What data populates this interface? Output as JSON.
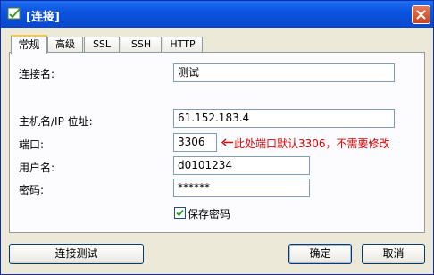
{
  "window": {
    "title": "[连接]",
    "accent_color": "#0b54e0"
  },
  "tabs": [
    {
      "label": "常规",
      "active": true
    },
    {
      "label": "高级",
      "active": false
    },
    {
      "label": "SSL",
      "active": false
    },
    {
      "label": "SSH",
      "active": false
    },
    {
      "label": "HTTP",
      "active": false
    }
  ],
  "form": {
    "connection_name_label": "连接名:",
    "connection_name_value": "测试",
    "host_label": "主机名/IP 位址:",
    "host_value": "61.152.183.4",
    "port_label": "端口:",
    "port_value": "3306",
    "port_annotation": "此处端口默认3306，不需要修改",
    "annotation_color": "#e00000",
    "username_label": "用户名:",
    "username_value": "d0101234",
    "password_label": "密码:",
    "password_value": "******",
    "save_password_label": "保存密码",
    "save_password_checked": true
  },
  "buttons": {
    "test_connection": "连接测试",
    "ok": "确定",
    "cancel": "取消"
  },
  "icons": [
    "app-icon",
    "close-icon",
    "checkmark-icon",
    "arrow-left-icon"
  ]
}
